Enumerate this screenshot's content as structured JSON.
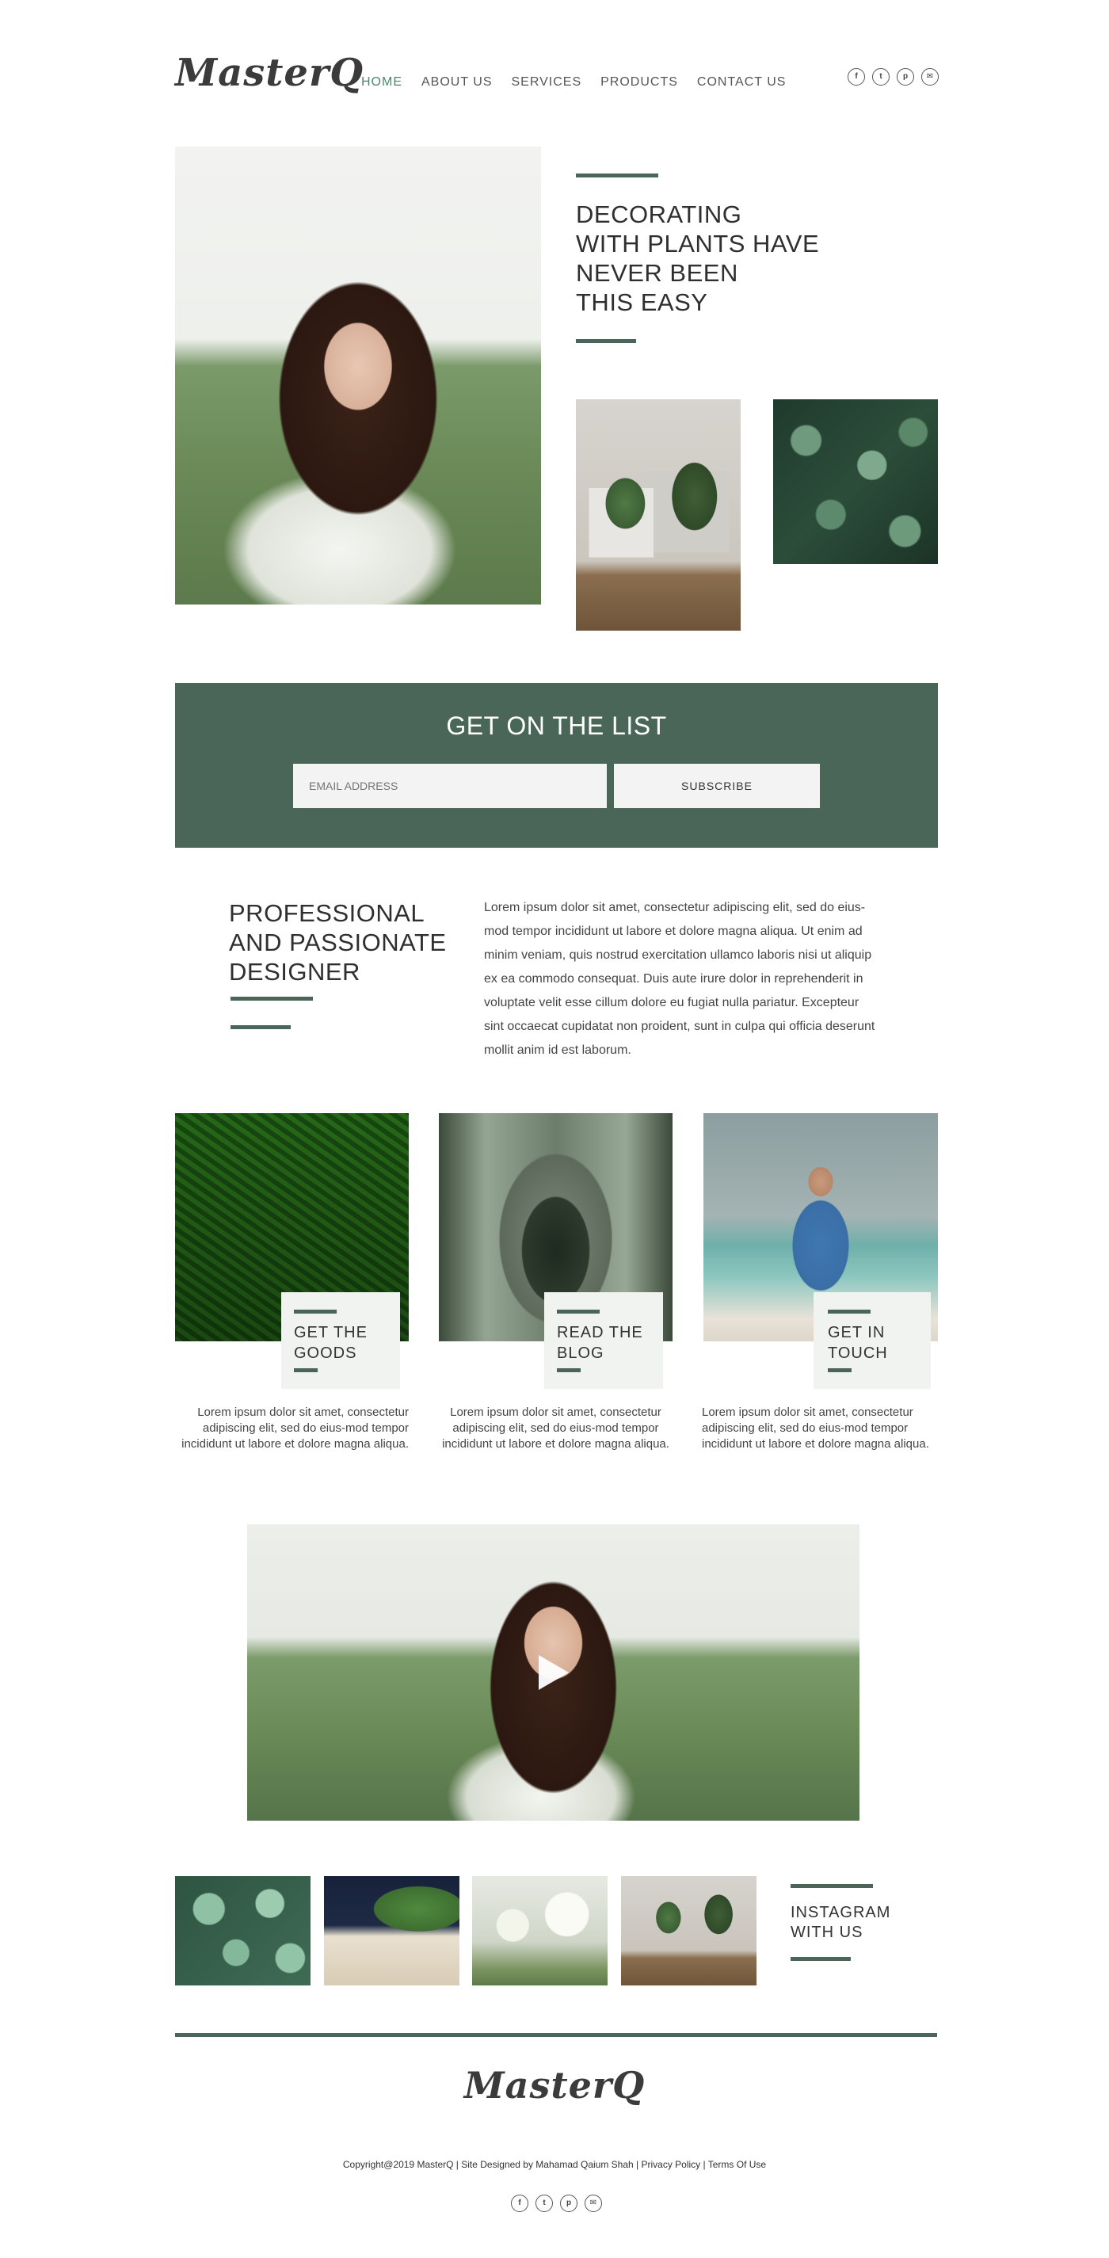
{
  "brand": {
    "logo": "MasterQ"
  },
  "nav": {
    "items": [
      {
        "label": "HOME",
        "active": true
      },
      {
        "label": "ABOUT US",
        "active": false
      },
      {
        "label": "SERVICES",
        "active": false
      },
      {
        "label": "PRODUCTS",
        "active": false
      },
      {
        "label": "CONTACT US",
        "active": false
      }
    ]
  },
  "social": {
    "icons": [
      "facebook-icon",
      "twitter-icon",
      "pinterest-icon",
      "email-icon"
    ],
    "glyphs": [
      "f",
      "t",
      "p",
      "✉"
    ]
  },
  "hero": {
    "title_lines": [
      "DECORATING",
      "WITH PLANTS HAVE",
      "NEVER BEEN",
      "THIS EASY"
    ]
  },
  "newsletter": {
    "title": "GET ON THE LIST",
    "email_placeholder": "EMAIL ADDRESS",
    "button_label": "SUBSCRIBE"
  },
  "about": {
    "title_lines": [
      "PROFESSIONAL",
      "AND PASSIONATE",
      "DESIGNER"
    ],
    "body": "Lorem ipsum dolor sit amet, consectetur adipiscing elit, sed do eius-mod tempor incididunt ut labore et dolore magna aliqua. Ut enim ad minim veniam, quis nostrud exercitation ullamco laboris nisi ut aliquip ex ea commodo consequat. Duis aute irure dolor in reprehenderit in voluptate velit esse cillum dolore eu fugiat nulla pariatur. Excepteur sint occaecat cupidatat non proident, sunt in culpa qui officia deserunt mollit anim id est laborum."
  },
  "cards": [
    {
      "label_lines": [
        "GET THE",
        "GOODS"
      ],
      "text": "Lorem ipsum dolor sit amet, consectetur adipiscing elit, sed do eius-mod tempor incididunt ut labore et dolore magna aliqua."
    },
    {
      "label_lines": [
        "READ THE",
        "BLOG"
      ],
      "text": "Lorem ipsum dolor sit amet, consectetur adipiscing elit, sed do eius-mod tempor incididunt ut labore et dolore magna aliqua."
    },
    {
      "label_lines": [
        "GET IN",
        "TOUCH"
      ],
      "text": "Lorem ipsum dolor sit amet, consectetur adipiscing elit, sed do eius-mod tempor incididunt ut labore et dolore magna aliqua."
    }
  ],
  "instagram": {
    "title_lines": [
      "INSTAGRAM",
      "WITH US"
    ]
  },
  "footer": {
    "logo": "MasterQ",
    "copyright": "Copyright@2019 MasterQ | Site Designed by Mahamad Qaium Shah | Privacy Policy | Terms Of Use"
  },
  "colors": {
    "accent": "#4a6658",
    "nav_active": "#4a8a6a",
    "panel": "#f1f3f1"
  }
}
